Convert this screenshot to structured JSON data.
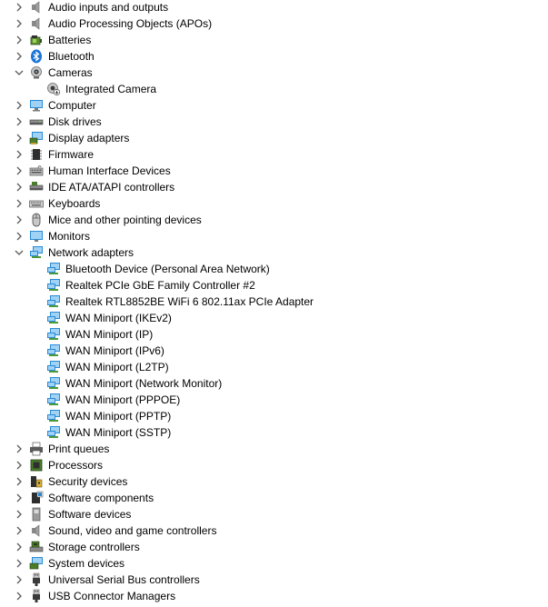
{
  "tree": [
    {
      "label": "Audio inputs and outputs",
      "icon": "speaker-icon",
      "level": 0,
      "expanded": false
    },
    {
      "label": "Audio Processing Objects (APOs)",
      "icon": "speaker-icon",
      "level": 0,
      "expanded": false
    },
    {
      "label": "Batteries",
      "icon": "battery-icon",
      "level": 0,
      "expanded": false
    },
    {
      "label": "Bluetooth",
      "icon": "bluetooth-icon",
      "level": 0,
      "expanded": false
    },
    {
      "label": "Cameras",
      "icon": "camera-icon",
      "level": 0,
      "expanded": true
    },
    {
      "label": "Integrated Camera",
      "icon": "camera-device-icon",
      "level": 1
    },
    {
      "label": "Computer",
      "icon": "computer-icon",
      "level": 0,
      "expanded": false
    },
    {
      "label": "Disk drives",
      "icon": "disk-drive-icon",
      "level": 0,
      "expanded": false
    },
    {
      "label": "Display adapters",
      "icon": "display-adapter-icon",
      "level": 0,
      "expanded": false
    },
    {
      "label": "Firmware",
      "icon": "firmware-chip-icon",
      "level": 0,
      "expanded": false
    },
    {
      "label": "Human Interface Devices",
      "icon": "hid-icon",
      "level": 0,
      "expanded": false
    },
    {
      "label": "IDE ATA/ATAPI controllers",
      "icon": "ide-controller-icon",
      "level": 0,
      "expanded": false
    },
    {
      "label": "Keyboards",
      "icon": "keyboard-icon",
      "level": 0,
      "expanded": false
    },
    {
      "label": "Mice and other pointing devices",
      "icon": "mouse-icon",
      "level": 0,
      "expanded": false
    },
    {
      "label": "Monitors",
      "icon": "monitor-icon",
      "level": 0,
      "expanded": false
    },
    {
      "label": "Network adapters",
      "icon": "network-adapter-icon",
      "level": 0,
      "expanded": true
    },
    {
      "label": "Bluetooth Device (Personal Area Network)",
      "icon": "network-adapter-icon",
      "level": 1
    },
    {
      "label": "Realtek PCIe GbE Family Controller #2",
      "icon": "network-adapter-icon",
      "level": 1
    },
    {
      "label": "Realtek RTL8852BE WiFi 6 802.11ax PCIe Adapter",
      "icon": "network-adapter-icon",
      "level": 1
    },
    {
      "label": "WAN Miniport (IKEv2)",
      "icon": "network-adapter-icon",
      "level": 1
    },
    {
      "label": "WAN Miniport (IP)",
      "icon": "network-adapter-icon",
      "level": 1
    },
    {
      "label": "WAN Miniport (IPv6)",
      "icon": "network-adapter-icon",
      "level": 1
    },
    {
      "label": "WAN Miniport (L2TP)",
      "icon": "network-adapter-icon",
      "level": 1
    },
    {
      "label": "WAN Miniport (Network Monitor)",
      "icon": "network-adapter-icon",
      "level": 1
    },
    {
      "label": "WAN Miniport (PPPOE)",
      "icon": "network-adapter-icon",
      "level": 1
    },
    {
      "label": "WAN Miniport (PPTP)",
      "icon": "network-adapter-icon",
      "level": 1
    },
    {
      "label": "WAN Miniport (SSTP)",
      "icon": "network-adapter-icon",
      "level": 1
    },
    {
      "label": "Print queues",
      "icon": "printer-icon",
      "level": 0,
      "expanded": false
    },
    {
      "label": "Processors",
      "icon": "processor-icon",
      "level": 0,
      "expanded": false
    },
    {
      "label": "Security devices",
      "icon": "security-device-icon",
      "level": 0,
      "expanded": false
    },
    {
      "label": "Software components",
      "icon": "software-component-icon",
      "level": 0,
      "expanded": false
    },
    {
      "label": "Software devices",
      "icon": "software-device-icon",
      "level": 0,
      "expanded": false
    },
    {
      "label": "Sound, video and game controllers",
      "icon": "speaker-icon",
      "level": 0,
      "expanded": false
    },
    {
      "label": "Storage controllers",
      "icon": "storage-controller-icon",
      "level": 0,
      "expanded": false
    },
    {
      "label": "System devices",
      "icon": "system-device-icon",
      "level": 0,
      "expanded": false
    },
    {
      "label": "Universal Serial Bus controllers",
      "icon": "usb-icon",
      "level": 0,
      "expanded": false
    },
    {
      "label": "USB Connector Managers",
      "icon": "usb-icon",
      "level": 0,
      "expanded": false
    }
  ],
  "colors": {
    "chevron": "#5a5a5a",
    "monitor_blue": "#2a8ad4",
    "screen_light": "#9fd2f5",
    "bluetooth": "#1a73d9",
    "chip_green": "#4a7d2a",
    "chip_dark": "#333333",
    "gray": "#7a7a7a"
  }
}
